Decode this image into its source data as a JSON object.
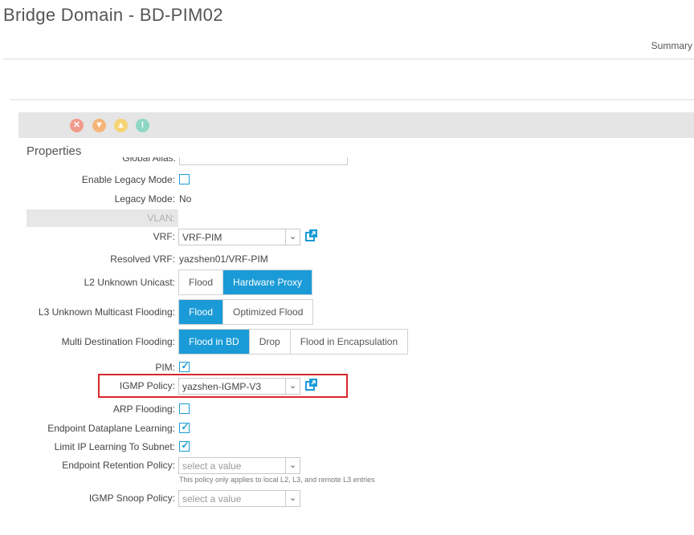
{
  "header": {
    "title": "Bridge Domain - BD-PIM02",
    "summary_tab": "Summary"
  },
  "fault_counts": {
    "critical_icon": "critical-fault-icon",
    "major_icon": "major-fault-icon",
    "minor_icon": "minor-fault-icon",
    "warning_icon": "warning-fault-icon",
    "colors": {
      "critical": "#f19b8c",
      "major": "#f5b57a",
      "minor": "#f6d474",
      "warning": "#8fd7c4"
    }
  },
  "properties": {
    "heading": "Properties",
    "clipped_label": "Global Alias:",
    "enable_legacy_mode": {
      "label": "Enable Legacy Mode:",
      "checked": false
    },
    "legacy_mode": {
      "label": "Legacy Mode:",
      "value": "No"
    },
    "vlan": {
      "label": "VLAN:"
    },
    "vrf": {
      "label": "VRF:",
      "value": "VRF-PIM"
    },
    "resolved_vrf": {
      "label": "Resolved VRF:",
      "value": "yazshen01/VRF-PIM"
    },
    "l2_unknown_unicast": {
      "label": "L2 Unknown Unicast:",
      "options": [
        "Flood",
        "Hardware Proxy"
      ],
      "selected": "Hardware Proxy"
    },
    "l3_unknown_multicast": {
      "label": "L3 Unknown Multicast Flooding:",
      "options": [
        "Flood",
        "Optimized Flood"
      ],
      "selected": "Flood"
    },
    "multi_destination": {
      "label": "Multi Destination Flooding:",
      "options": [
        "Flood in BD",
        "Drop",
        "Flood in Encapsulation"
      ],
      "selected": "Flood in BD"
    },
    "pim": {
      "label": "PIM:",
      "checked": true
    },
    "igmp_policy": {
      "label": "IGMP Policy:",
      "value": "yazshen-IGMP-V3"
    },
    "arp_flooding": {
      "label": "ARP Flooding:",
      "checked": false
    },
    "endpoint_dataplane_learning": {
      "label": "Endpoint Dataplane Learning:",
      "checked": true
    },
    "limit_ip_learning": {
      "label": "Limit IP Learning To Subnet:",
      "checked": true
    },
    "endpoint_retention_policy": {
      "label": "Endpoint Retention Policy:",
      "placeholder": "select a value",
      "hint": "This policy only applies to local L2, L3, and remote L3 entries"
    },
    "igmp_snoop_policy": {
      "label": "IGMP Snoop Policy:",
      "placeholder": "select a value"
    }
  },
  "accent_color": "#1a9bd7",
  "highlight_color": "#d9262c"
}
